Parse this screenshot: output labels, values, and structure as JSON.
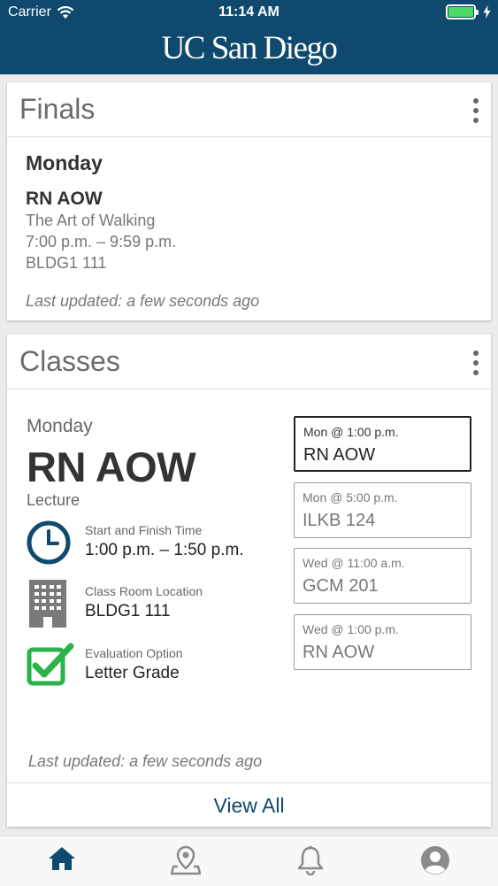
{
  "status_bar": {
    "carrier": "Carrier",
    "time": "11:14 AM"
  },
  "header": {
    "logo_text": "UC San Diego",
    "background": "#0f4a6e"
  },
  "finals": {
    "title": "Finals",
    "day": "Monday",
    "course": "RN AOW",
    "course_name": "The Art of Walking",
    "time": "7:00 p.m. – 9:59 p.m.",
    "location": "BLDG1 111",
    "updated": "Last updated: a few seconds ago"
  },
  "classes": {
    "title": "Classes",
    "day": "Monday",
    "course": "RN AOW",
    "type": "Lecture",
    "time_label": "Start and Finish Time",
    "time_value": "1:00 p.m. – 1:50 p.m.",
    "room_label": "Class Room Location",
    "room_value": "BLDG1 111",
    "eval_label": "Evaluation Option",
    "eval_value": "Letter Grade",
    "slots": [
      {
        "time": "Mon @ 1:00 p.m.",
        "location": "RN AOW",
        "selected": true
      },
      {
        "time": "Mon @ 5:00 p.m.",
        "location": "ILKB 124",
        "selected": false
      },
      {
        "time": "Wed @ 11:00 a.m.",
        "location": "GCM 201",
        "selected": false
      },
      {
        "time": "Wed @ 1:00 p.m.",
        "location": "RN AOW",
        "selected": false
      }
    ],
    "updated": "Last updated: a few seconds ago",
    "view_all": "View All"
  },
  "tabbar": {
    "items": [
      "home-icon",
      "map-pin-icon",
      "bell-icon",
      "profile-icon"
    ],
    "active": "home-icon",
    "active_color": "#0f4a6e"
  }
}
